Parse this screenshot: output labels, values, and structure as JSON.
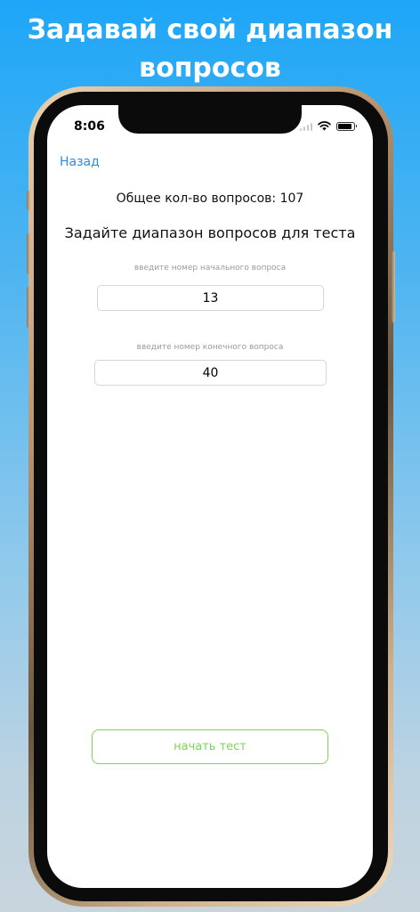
{
  "headline": {
    "line1": "Задавай свой диапазон",
    "line2": "вопросов"
  },
  "status_bar": {
    "time": "8:06"
  },
  "nav": {
    "back_label": "Назад"
  },
  "content": {
    "total_questions_text": "Общее кол-во вопросов: 107",
    "title": "Задайте диапазон вопросов для теста",
    "start_hint": "введите номер начального вопроса",
    "start_value": "13",
    "end_hint": "введите номер конечного вопроса",
    "end_value": "40",
    "start_button_label": "начать тест"
  },
  "colors": {
    "accent_link": "#2b8be6",
    "start_button": "#7fd35a"
  },
  "icons": [
    "signal-icon",
    "wifi-icon",
    "battery-icon"
  ]
}
